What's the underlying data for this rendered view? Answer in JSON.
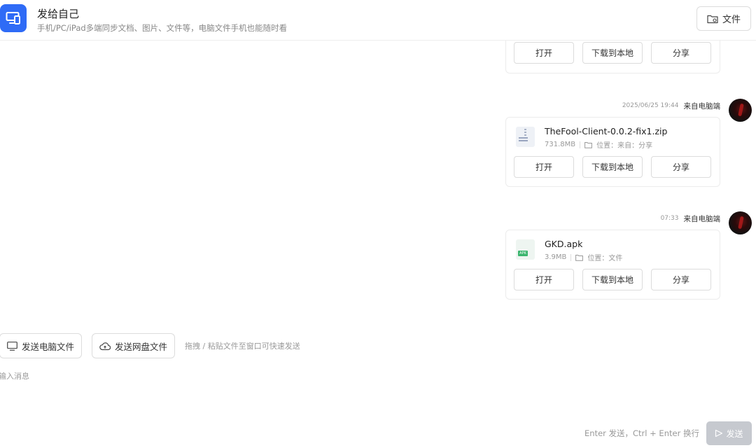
{
  "header": {
    "title": "发给自己",
    "subtitle": "手机/PC/iPad多端同步文档、图片、文件等，电脑文件手机也能随时看",
    "files_button": "文件"
  },
  "actions": {
    "open": "打开",
    "download": "下载到本地",
    "share": "分享"
  },
  "messages": [
    {
      "time": "2025/06/25 19:44",
      "source": "来自电脑端",
      "file": {
        "name": "TheFool-Client-0.0.2-fix1.zip",
        "size": "731.8MB",
        "location": "位置：来自：分享",
        "icon": "zip-file-icon"
      }
    },
    {
      "time": "07:33",
      "source": "来自电脑端",
      "file": {
        "name": "GKD.apk",
        "size": "3.9MB",
        "location": "位置：文件",
        "icon": "apk-file-icon"
      }
    }
  ],
  "toolbar": {
    "send_pc_file": "发送电脑文件",
    "send_cloud_file": "发送网盘文件",
    "drop_hint": "拖拽 / 粘贴文件至窗口可快速发送"
  },
  "composer": {
    "placeholder": "输入消息",
    "send_hint": "Enter 发送，Ctrl + Enter 换行",
    "send_label": "发送"
  },
  "colors": {
    "accent": "#2f6bf6",
    "send_disabled": "#c6c9cf"
  }
}
